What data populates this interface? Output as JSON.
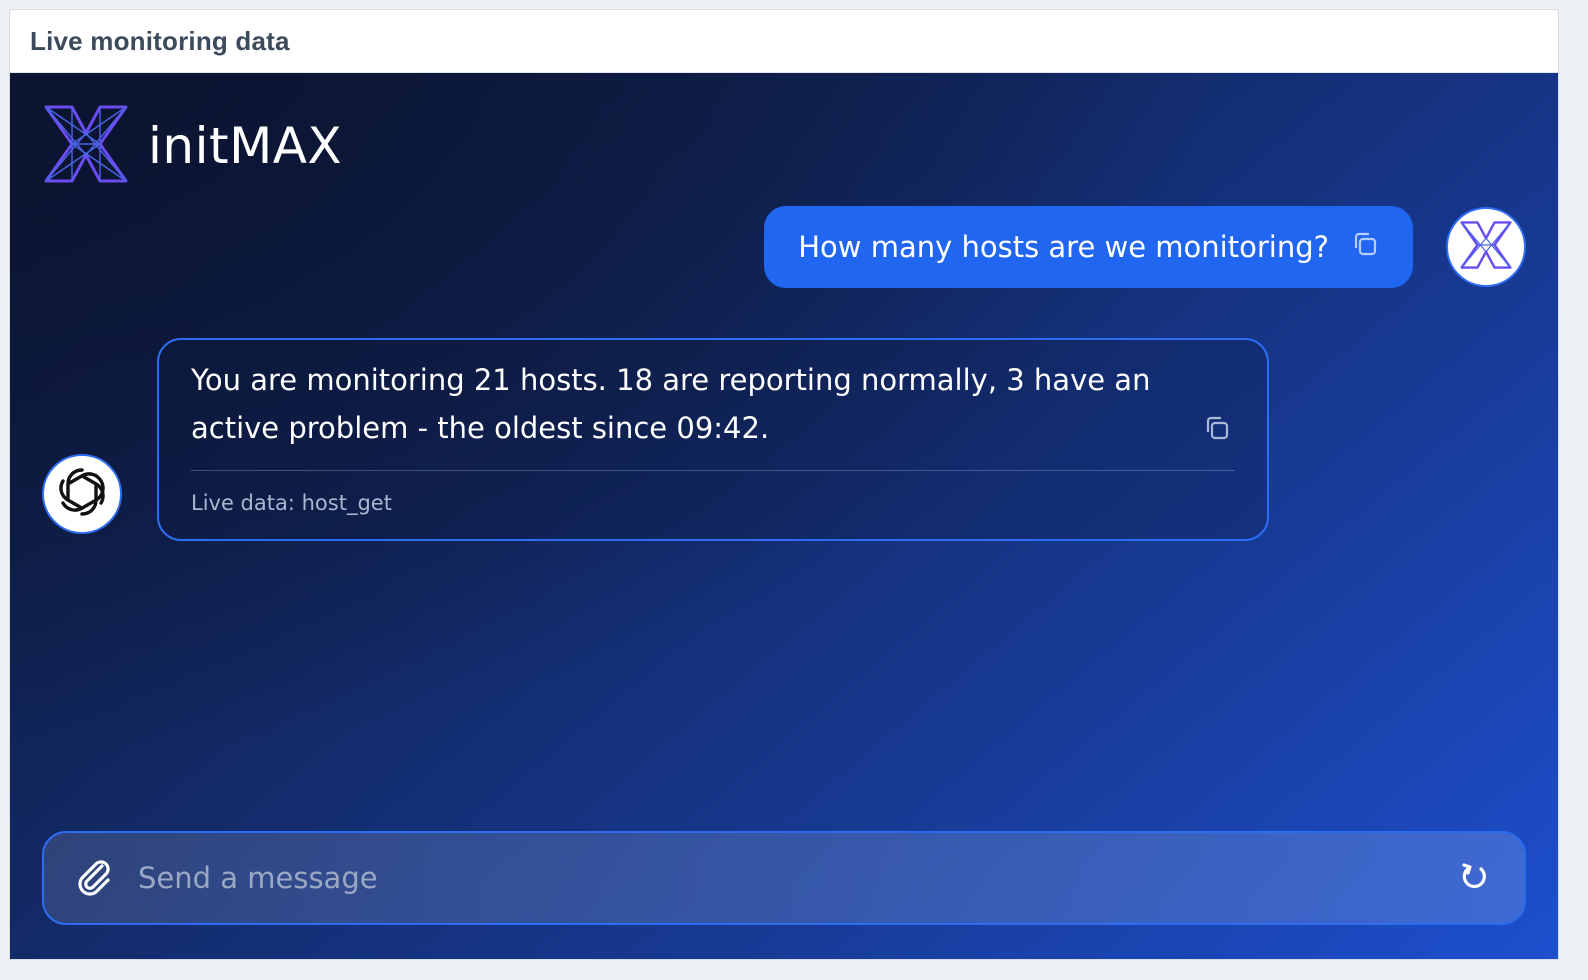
{
  "widget": {
    "title": "Live monitoring data"
  },
  "brand": {
    "name": "initMAX",
    "logo_icon": "initmax-logo-icon"
  },
  "conversation": {
    "user_message": {
      "text": "How many hosts are we monitoring?",
      "avatar_icon": "initmax-logo-icon",
      "action_icon": "copy-icon"
    },
    "assistant_message": {
      "text": "You are monitoring 21 hosts. 18 are reporting normally, 3 have an active problem - the oldest since 09:42.",
      "meta": "Live data: host_get",
      "avatar_icon": "openai-logo-icon",
      "action_icon": "copy-icon"
    }
  },
  "composer": {
    "placeholder": "Send a message",
    "value": "",
    "attach_icon": "paperclip-icon",
    "reset_icon": "refresh-icon"
  },
  "colors": {
    "user_bubble": "#2166f1",
    "accent_border": "#2e6df2",
    "logo_purple": "#6a4cf0"
  }
}
